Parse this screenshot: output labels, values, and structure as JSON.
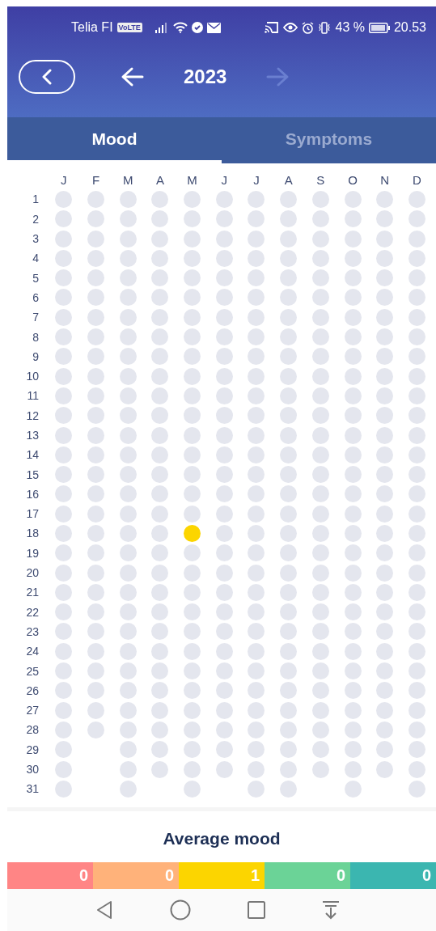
{
  "status_bar": {
    "carrier": "Telia FI",
    "network_badge": "VoLTE",
    "battery": "43 %",
    "time": "20.53"
  },
  "header": {
    "year": "2023",
    "next_disabled": true
  },
  "tabs": [
    {
      "label": "Mood",
      "selected": true
    },
    {
      "label": "Symptoms",
      "selected": false
    }
  ],
  "calendar": {
    "months": [
      "J",
      "F",
      "M",
      "A",
      "M",
      "J",
      "J",
      "A",
      "S",
      "O",
      "N",
      "D"
    ],
    "days": [
      {
        "label": "1"
      },
      {
        "label": "2"
      },
      {
        "label": "3"
      },
      {
        "label": "4"
      },
      {
        "label": "5"
      },
      {
        "label": "6"
      },
      {
        "label": "7"
      },
      {
        "label": "8"
      },
      {
        "label": "9"
      },
      {
        "label": "10"
      },
      {
        "label": "11"
      },
      {
        "label": "12"
      },
      {
        "label": "13"
      },
      {
        "label": "14"
      },
      {
        "label": "15"
      },
      {
        "label": "16"
      },
      {
        "label": "17"
      },
      {
        "label": "18",
        "moods": [
          {
            "logged": false
          },
          {
            "logged": false
          },
          {
            "logged": false
          },
          {
            "logged": false
          },
          {
            "logged": true,
            "color": "#fcd500"
          },
          {
            "logged": false
          },
          {
            "logged": false
          },
          {
            "logged": false
          },
          {
            "logged": false
          },
          {
            "logged": false
          },
          {
            "logged": false
          },
          {
            "logged": false
          }
        ]
      },
      {
        "label": "19"
      },
      {
        "label": "20"
      },
      {
        "label": "21"
      },
      {
        "label": "22"
      },
      {
        "label": "23"
      },
      {
        "label": "24"
      },
      {
        "label": "25"
      },
      {
        "label": "26"
      },
      {
        "label": "27"
      },
      {
        "label": "28"
      },
      {
        "label": "29"
      },
      {
        "label": "30"
      },
      {
        "label": "31"
      }
    ]
  },
  "average": {
    "title": "Average mood",
    "segments": [
      {
        "count": "0",
        "color": "#ff8585"
      },
      {
        "count": "0",
        "color": "#ffb27a"
      },
      {
        "count": "1",
        "color": "#fcd500"
      },
      {
        "count": "0",
        "color": "#6bd397"
      },
      {
        "count": "0",
        "color": "#3bb6b0"
      }
    ]
  }
}
